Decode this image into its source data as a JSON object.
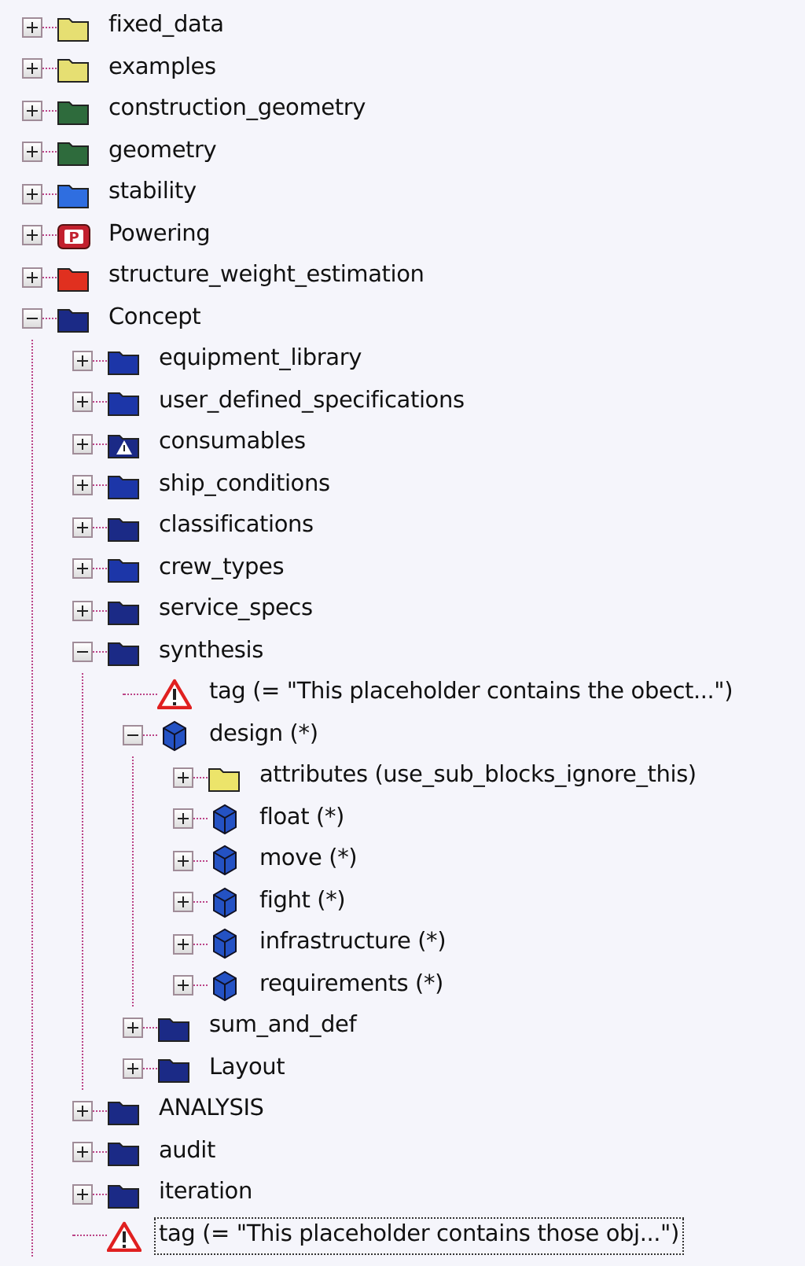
{
  "tree": [
    {
      "label": "fixed_data",
      "kind": "folder",
      "color": "#e6df72",
      "expanded": false,
      "selected": false
    },
    {
      "label": "examples",
      "kind": "folder",
      "color": "#e6df72",
      "expanded": false,
      "selected": false
    },
    {
      "label": "construction_geometry",
      "kind": "folder",
      "color": "#2e6b3c",
      "expanded": false,
      "selected": false
    },
    {
      "label": "geometry",
      "kind": "folder",
      "color": "#2e6b3c",
      "expanded": false,
      "selected": false
    },
    {
      "label": "stability",
      "kind": "folder",
      "color": "#2f6ee0",
      "expanded": false,
      "selected": false
    },
    {
      "label": "Powering",
      "kind": "folder_letter",
      "badge": "P",
      "color": "#c2202e",
      "expanded": false,
      "selected": false
    },
    {
      "label": "structure_weight_estimation",
      "kind": "folder",
      "color": "#e0301f",
      "expanded": false,
      "selected": false
    },
    {
      "label": "Concept",
      "kind": "folder",
      "color": "#1b2a86",
      "expanded": true,
      "selected": false,
      "children": [
        {
          "label": "equipment_library",
          "kind": "folder",
          "color": "#1c36a8",
          "expanded": false,
          "selected": false
        },
        {
          "label": "user_defined_specifications",
          "kind": "folder",
          "color": "#1c36a8",
          "expanded": false,
          "selected": false
        },
        {
          "label": "consumables",
          "kind": "folder_warning",
          "color": "#1b2a86",
          "expanded": false,
          "selected": false
        },
        {
          "label": "ship_conditions",
          "kind": "folder",
          "color": "#1c36a8",
          "expanded": false,
          "selected": false
        },
        {
          "label": "classifications",
          "kind": "folder",
          "color": "#1b2a86",
          "expanded": false,
          "selected": false
        },
        {
          "label": "crew_types",
          "kind": "folder",
          "color": "#1c36a8",
          "expanded": false,
          "selected": false
        },
        {
          "label": "service_specs",
          "kind": "folder",
          "color": "#1b2a86",
          "expanded": false,
          "selected": false
        },
        {
          "label": "synthesis",
          "kind": "folder",
          "color": "#1b2a86",
          "expanded": true,
          "selected": false,
          "children": [
            {
              "label": "tag (= \"This placeholder contains the obect...\")",
              "kind": "warning",
              "selected": false
            },
            {
              "label": "design (*)",
              "kind": "cube",
              "color": "#2452c4",
              "expanded": true,
              "selected": false,
              "children": [
                {
                  "label": "attributes (use_sub_blocks_ignore_this)",
                  "kind": "folder",
                  "color": "#ece46a",
                  "expanded": false,
                  "selected": false
                },
                {
                  "label": "float (*)",
                  "kind": "cube",
                  "color": "#2452c4",
                  "expanded": false,
                  "selected": false
                },
                {
                  "label": "move (*)",
                  "kind": "cube",
                  "color": "#2452c4",
                  "expanded": false,
                  "selected": false
                },
                {
                  "label": "fight (*)",
                  "kind": "cube",
                  "color": "#2452c4",
                  "expanded": false,
                  "selected": false
                },
                {
                  "label": "infrastructure (*)",
                  "kind": "cube",
                  "color": "#2452c4",
                  "expanded": false,
                  "selected": false
                },
                {
                  "label": "requirements (*)",
                  "kind": "cube",
                  "color": "#2452c4",
                  "expanded": false,
                  "selected": false
                }
              ]
            },
            {
              "label": "sum_and_def",
              "kind": "folder",
              "color": "#1b2a86",
              "expanded": false,
              "selected": false
            },
            {
              "label": "Layout",
              "kind": "folder",
              "color": "#1b2a86",
              "expanded": false,
              "selected": false
            }
          ]
        },
        {
          "label": "ANALYSIS",
          "kind": "folder",
          "color": "#1b2a86",
          "expanded": false,
          "selected": false
        },
        {
          "label": "audit",
          "kind": "folder",
          "color": "#1b2a86",
          "expanded": false,
          "selected": false
        },
        {
          "label": "iteration",
          "kind": "folder",
          "color": "#1b2a86",
          "expanded": false,
          "selected": false
        },
        {
          "label": "tag (= \"This placeholder contains those obj...\")",
          "kind": "warning",
          "selected": true
        }
      ]
    }
  ]
}
